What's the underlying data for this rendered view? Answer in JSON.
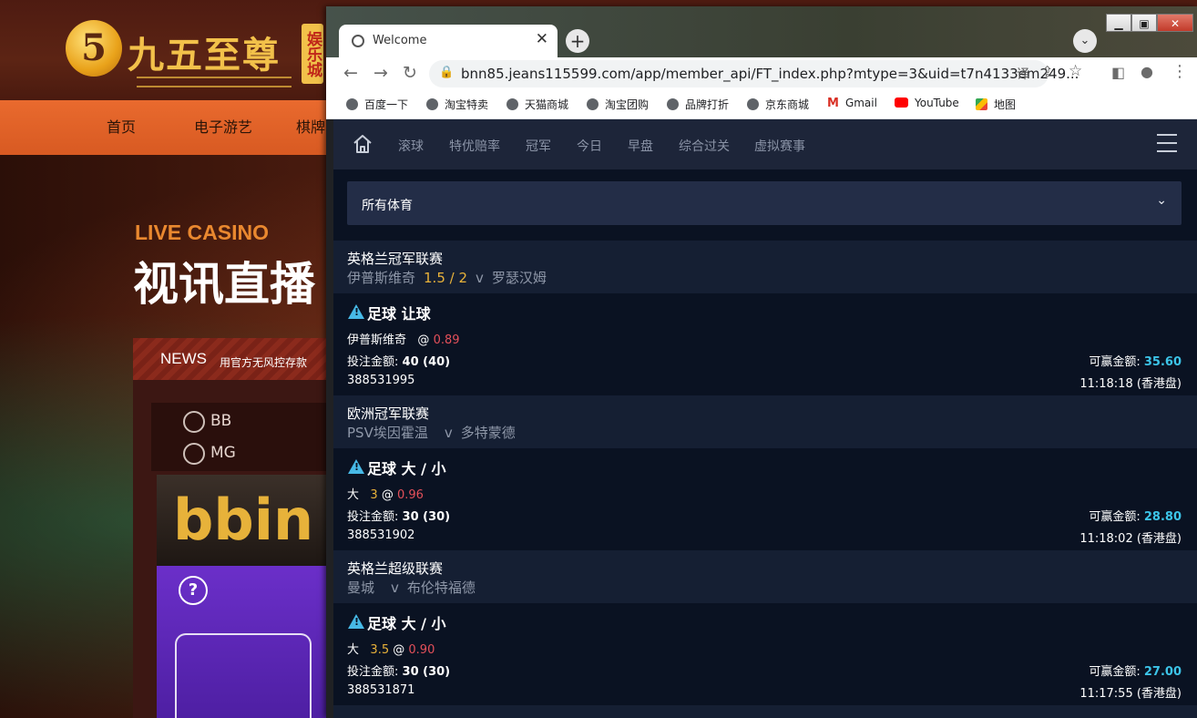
{
  "background_site": {
    "logo_mark": "5",
    "logo_text": "九五至尊",
    "logo_tag": "娱乐城",
    "nav": [
      "首页",
      "电子游艺",
      "棋牌"
    ],
    "live_label": "LIVE CASINO",
    "live_title": "视讯直播",
    "news_label": "NEWS",
    "news_text": "用官方无风控存款",
    "providers": [
      "BB",
      "MG"
    ],
    "bbin_logo": "bbin",
    "help": "?"
  },
  "browser": {
    "tab_title": "Welcome",
    "tab_close": "✕",
    "new_tab": "+",
    "tab_search": "⌄",
    "window_controls": [
      "▁",
      "▣",
      "✕"
    ],
    "url": "bnn85.jeans115599.com/app/member_api/FT_index.php?mtype=3&uid=t7n4133em249...",
    "bookmarks": [
      "百度一下",
      "淘宝特卖",
      "天猫商城",
      "淘宝团购",
      "品牌打折",
      "京东商城",
      "Gmail",
      "YouTube",
      "地图"
    ]
  },
  "app": {
    "nav": [
      "滚球",
      "特优赔率",
      "冠军",
      "今日",
      "早盘",
      "综合过关",
      "虚拟赛事"
    ],
    "sport_select": "所有体育",
    "labels": {
      "stake": "投注金额:",
      "win": "可赢金额:"
    },
    "bets": [
      {
        "league": "英格兰冠军联赛",
        "home": "伊普斯维奇",
        "line": "1.5 / 2",
        "vs": "v",
        "away": "罗瑟汉姆",
        "type": "足球 让球",
        "pick": "伊普斯维奇",
        "pick_line": "",
        "at": "@",
        "odds": "0.89",
        "stake": "40 (40)",
        "win": "35.60",
        "id": "388531995",
        "time": "11:18:18 (香港盘)"
      },
      {
        "league": "欧洲冠军联赛",
        "home": "PSV埃因霍温",
        "line": "",
        "vs": "v",
        "away": "多特蒙德",
        "type": "足球 大 / 小",
        "pick": "大",
        "pick_line": "3",
        "at": "@",
        "odds": "0.96",
        "stake": "30 (30)",
        "win": "28.80",
        "id": "388531902",
        "time": "11:18:02 (香港盘)"
      },
      {
        "league": "英格兰超级联赛",
        "home": "曼城",
        "line": "",
        "vs": "v",
        "away": "布伦特福德",
        "type": "足球 大 / 小",
        "pick": "大",
        "pick_line": "3.5",
        "at": "@",
        "odds": "0.90",
        "stake": "30 (30)",
        "win": "27.00",
        "id": "388531871",
        "time": "11:17:55 (香港盘)"
      }
    ]
  }
}
